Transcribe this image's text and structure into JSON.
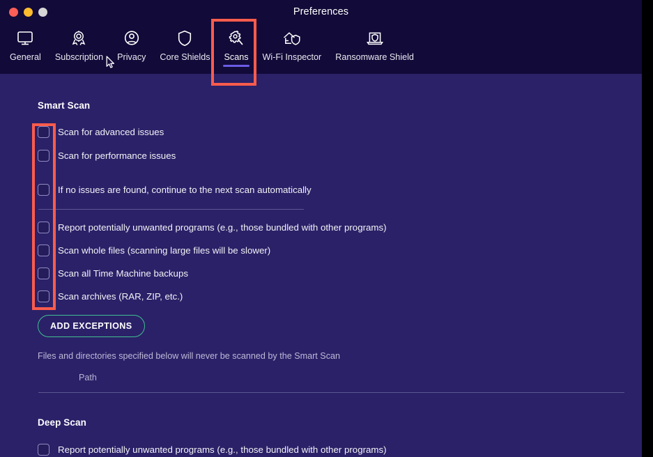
{
  "window": {
    "title": "Preferences",
    "traffic_lights": [
      {
        "name": "close",
        "color": "#fb5f57"
      },
      {
        "name": "minimize",
        "color": "#fcbc2e"
      },
      {
        "name": "zoom",
        "color": "#d6d6d6"
      }
    ]
  },
  "toolbar": {
    "active_tab": "Scans",
    "items": [
      {
        "label": "General",
        "icon": "monitor-icon"
      },
      {
        "label": "Subscription",
        "icon": "award-ribbon-icon"
      },
      {
        "label": "Privacy",
        "icon": "user-circle-icon"
      },
      {
        "label": "Core Shields",
        "icon": "shield-icon"
      },
      {
        "label": "Scans",
        "icon": "magnifier-gear-icon"
      },
      {
        "label": "Wi-Fi Inspector",
        "icon": "house-shield-icon"
      },
      {
        "label": "Ransomware Shield",
        "icon": "laptop-shield-icon"
      }
    ]
  },
  "sections": {
    "smart_scan": {
      "title": "Smart Scan",
      "group_one": [
        {
          "label": "Scan for advanced issues",
          "checked": false
        },
        {
          "label": "Scan for performance issues",
          "checked": false
        }
      ],
      "continue_option": {
        "label": "If no issues are found, continue to the next scan automatically",
        "checked": false
      },
      "group_two": [
        {
          "label": "Report potentially unwanted programs (e.g., those bundled with other programs)",
          "checked": false
        },
        {
          "label": "Scan whole files (scanning large files will be slower)",
          "checked": false
        },
        {
          "label": "Scan all Time Machine backups",
          "checked": false
        },
        {
          "label": "Scan archives (RAR, ZIP, etc.)",
          "checked": false
        }
      ],
      "add_exceptions_label": "ADD EXCEPTIONS",
      "exceptions_note": "Files and directories specified below will never be scanned by the Smart Scan",
      "path_column_header": "Path"
    },
    "deep_scan": {
      "title": "Deep Scan",
      "options": [
        {
          "label": "Report potentially unwanted programs (e.g., those bundled with other programs)",
          "checked": false
        }
      ]
    }
  },
  "annotations": [
    {
      "name": "scans-tab-highlight",
      "color": "#fb5c4c"
    },
    {
      "name": "checkbox-column-highlight",
      "color": "#fb5c4c"
    }
  ],
  "colors": {
    "window_bg": "#2b2168",
    "chrome_bg": "#120a38",
    "accent_underline": "#6b5ce7",
    "button_border": "#3fbf91",
    "annotation": "#fb5c4c"
  }
}
